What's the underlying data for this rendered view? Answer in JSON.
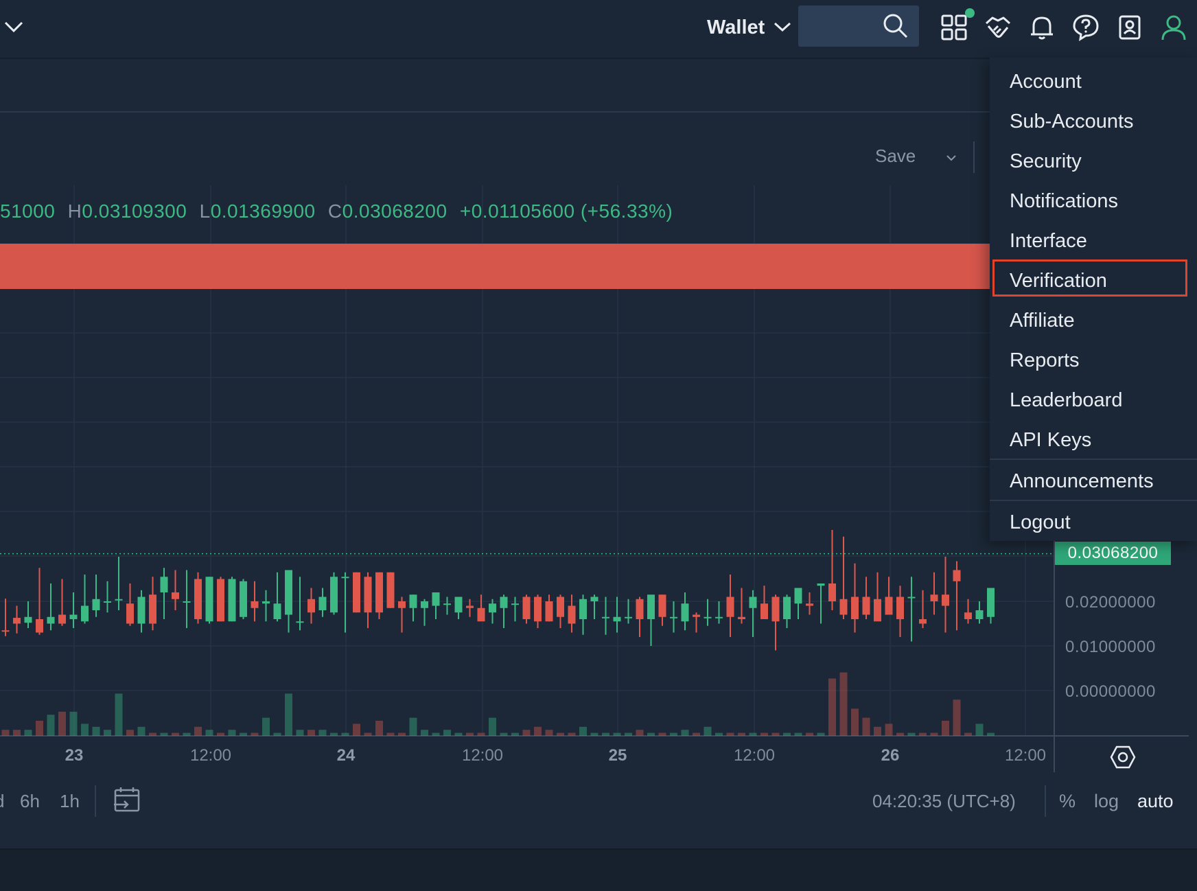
{
  "header": {
    "wallet_label": "Wallet",
    "search": {
      "value": "",
      "placeholder": ""
    },
    "icons": [
      "apps-grid-icon",
      "handshake-icon",
      "bell-icon",
      "help-icon",
      "contacts-icon",
      "user-icon"
    ],
    "notification_dot_color": "#3dba84"
  },
  "chart_toolbar": {
    "save_label": "Save"
  },
  "ohlc": {
    "open_value": "51000",
    "high_key": "H",
    "high_value": "0.03109300",
    "low_key": "L",
    "low_value": "0.01369900",
    "close_key": "C",
    "close_value": "0.03068200",
    "change": "+0.01105600 (+56.33%)"
  },
  "colors": {
    "up": "#3dba84",
    "down": "#e0574c",
    "banner": "#d6564c",
    "menu_highlight": "#e0442c"
  },
  "price_axis": {
    "last_price": "0.03068200",
    "labels": [
      "0.02000000",
      "0.01000000",
      "0.00000000"
    ]
  },
  "time_axis": {
    "labels": [
      {
        "text": "23",
        "bold": true
      },
      {
        "text": "12:00",
        "bold": false
      },
      {
        "text": "24",
        "bold": true
      },
      {
        "text": "12:00",
        "bold": false
      },
      {
        "text": "25",
        "bold": true
      },
      {
        "text": "12:00",
        "bold": false
      },
      {
        "text": "26",
        "bold": true
      },
      {
        "text": "12:00",
        "bold": false
      }
    ]
  },
  "bottom_toolbar": {
    "timeframes": [
      "d",
      "6h",
      "1h"
    ],
    "clock": "04:20:35 (UTC+8)",
    "options": {
      "percent": "%",
      "log": "log",
      "auto": "auto"
    }
  },
  "account_menu": {
    "items": [
      "Account",
      "Sub-Accounts",
      "Security",
      "Notifications",
      "Interface",
      "Verification",
      "Affiliate",
      "Reports",
      "Leaderboard",
      "API Keys",
      "Announcements",
      "Logout"
    ],
    "highlighted": "Verification"
  },
  "chart_data": {
    "type": "candlestick",
    "y_axis": {
      "range": [
        0,
        0.031
      ]
    },
    "last_price": 0.030682,
    "x_axis_ticks": [
      "23",
      "12:00",
      "24",
      "12:00",
      "25",
      "12:00",
      "26",
      "12:00"
    ],
    "candles": [
      {
        "o": 0.0135,
        "h": 0.0206,
        "l": 0.0122,
        "c": 0.0133,
        "v": 2
      },
      {
        "o": 0.0163,
        "h": 0.019,
        "l": 0.0128,
        "c": 0.015,
        "v": 2
      },
      {
        "o": 0.0152,
        "h": 0.02,
        "l": 0.014,
        "c": 0.0165,
        "v": 2
      },
      {
        "o": 0.016,
        "h": 0.0275,
        "l": 0.0125,
        "c": 0.013,
        "v": 5
      },
      {
        "o": 0.015,
        "h": 0.024,
        "l": 0.0135,
        "c": 0.0165,
        "v": 7
      },
      {
        "o": 0.017,
        "h": 0.025,
        "l": 0.0145,
        "c": 0.015,
        "v": 8
      },
      {
        "o": 0.016,
        "h": 0.022,
        "l": 0.014,
        "c": 0.017,
        "v": 8
      },
      {
        "o": 0.0155,
        "h": 0.026,
        "l": 0.015,
        "c": 0.019,
        "v": 4
      },
      {
        "o": 0.018,
        "h": 0.026,
        "l": 0.0165,
        "c": 0.0205,
        "v": 3
      },
      {
        "o": 0.02,
        "h": 0.0245,
        "l": 0.0175,
        "c": 0.02,
        "v": 2
      },
      {
        "o": 0.0205,
        "h": 0.03,
        "l": 0.018,
        "c": 0.0205,
        "v": 14
      },
      {
        "o": 0.0195,
        "h": 0.024,
        "l": 0.0145,
        "c": 0.015,
        "v": 2
      },
      {
        "o": 0.015,
        "h": 0.0225,
        "l": 0.013,
        "c": 0.021,
        "v": 3
      },
      {
        "o": 0.0215,
        "h": 0.0255,
        "l": 0.0135,
        "c": 0.015,
        "v": 1
      },
      {
        "o": 0.022,
        "h": 0.0275,
        "l": 0.016,
        "c": 0.0255,
        "v": 1
      },
      {
        "o": 0.022,
        "h": 0.027,
        "l": 0.018,
        "c": 0.0205,
        "v": 1
      },
      {
        "o": 0.02,
        "h": 0.027,
        "l": 0.014,
        "c": 0.02,
        "v": 1
      },
      {
        "o": 0.025,
        "h": 0.0265,
        "l": 0.015,
        "c": 0.016,
        "v": 3
      },
      {
        "o": 0.0155,
        "h": 0.0255,
        "l": 0.015,
        "c": 0.0255,
        "v": 2
      },
      {
        "o": 0.025,
        "h": 0.0255,
        "l": 0.0155,
        "c": 0.0155,
        "v": 1
      },
      {
        "o": 0.0155,
        "h": 0.0255,
        "l": 0.0155,
        "c": 0.025,
        "v": 2
      },
      {
        "o": 0.0165,
        "h": 0.025,
        "l": 0.016,
        "c": 0.0245,
        "v": 1
      },
      {
        "o": 0.02,
        "h": 0.0245,
        "l": 0.0155,
        "c": 0.0185,
        "v": 1
      },
      {
        "o": 0.0195,
        "h": 0.0225,
        "l": 0.0155,
        "c": 0.02,
        "v": 6
      },
      {
        "o": 0.016,
        "h": 0.0265,
        "l": 0.0155,
        "c": 0.0195,
        "v": 1
      },
      {
        "o": 0.017,
        "h": 0.027,
        "l": 0.013,
        "c": 0.027,
        "v": 14
      },
      {
        "o": 0.0155,
        "h": 0.0255,
        "l": 0.0135,
        "c": 0.0155,
        "v": 2
      },
      {
        "o": 0.0205,
        "h": 0.023,
        "l": 0.015,
        "c": 0.0175,
        "v": 2
      },
      {
        "o": 0.018,
        "h": 0.023,
        "l": 0.0165,
        "c": 0.021,
        "v": 2
      },
      {
        "o": 0.0175,
        "h": 0.0265,
        "l": 0.017,
        "c": 0.0255,
        "v": 1
      },
      {
        "o": 0.0255,
        "h": 0.0265,
        "l": 0.013,
        "c": 0.0255,
        "v": 1
      },
      {
        "o": 0.0265,
        "h": 0.0265,
        "l": 0.0175,
        "c": 0.0175,
        "v": 4
      },
      {
        "o": 0.0255,
        "h": 0.0265,
        "l": 0.014,
        "c": 0.0175,
        "v": 1
      },
      {
        "o": 0.0265,
        "h": 0.0265,
        "l": 0.016,
        "c": 0.0175,
        "v": 5
      },
      {
        "o": 0.0265,
        "h": 0.0265,
        "l": 0.0185,
        "c": 0.0185,
        "v": 1
      },
      {
        "o": 0.02,
        "h": 0.021,
        "l": 0.013,
        "c": 0.0185,
        "v": 1
      },
      {
        "o": 0.0185,
        "h": 0.0215,
        "l": 0.0155,
        "c": 0.0215,
        "v": 6
      },
      {
        "o": 0.0185,
        "h": 0.0205,
        "l": 0.0145,
        "c": 0.02,
        "v": 2
      },
      {
        "o": 0.019,
        "h": 0.022,
        "l": 0.016,
        "c": 0.022,
        "v": 1
      },
      {
        "o": 0.0195,
        "h": 0.021,
        "l": 0.017,
        "c": 0.0195,
        "v": 2
      },
      {
        "o": 0.0175,
        "h": 0.02,
        "l": 0.016,
        "c": 0.021,
        "v": 1
      },
      {
        "o": 0.019,
        "h": 0.0205,
        "l": 0.0165,
        "c": 0.0185,
        "v": 1
      },
      {
        "o": 0.0185,
        "h": 0.0215,
        "l": 0.016,
        "c": 0.0155,
        "v": 1
      },
      {
        "o": 0.0175,
        "h": 0.0205,
        "l": 0.015,
        "c": 0.0195,
        "v": 6
      },
      {
        "o": 0.0185,
        "h": 0.0215,
        "l": 0.014,
        "c": 0.021,
        "v": 1
      },
      {
        "o": 0.0195,
        "h": 0.021,
        "l": 0.0155,
        "c": 0.0195,
        "v": 1
      },
      {
        "o": 0.021,
        "h": 0.0215,
        "l": 0.015,
        "c": 0.016,
        "v": 2
      },
      {
        "o": 0.021,
        "h": 0.0215,
        "l": 0.014,
        "c": 0.0155,
        "v": 3
      },
      {
        "o": 0.02,
        "h": 0.0215,
        "l": 0.0155,
        "c": 0.0155,
        "v": 2
      },
      {
        "o": 0.021,
        "h": 0.0215,
        "l": 0.014,
        "c": 0.0165,
        "v": 1
      },
      {
        "o": 0.019,
        "h": 0.0215,
        "l": 0.013,
        "c": 0.015,
        "v": 1
      },
      {
        "o": 0.016,
        "h": 0.0215,
        "l": 0.0125,
        "c": 0.0205,
        "v": 3
      },
      {
        "o": 0.02,
        "h": 0.0215,
        "l": 0.016,
        "c": 0.021,
        "v": 1
      },
      {
        "o": 0.0165,
        "h": 0.021,
        "l": 0.0125,
        "c": 0.0165,
        "v": 1
      },
      {
        "o": 0.0155,
        "h": 0.021,
        "l": 0.013,
        "c": 0.0165,
        "v": 1
      },
      {
        "o": 0.0165,
        "h": 0.0205,
        "l": 0.015,
        "c": 0.0165,
        "v": 1
      },
      {
        "o": 0.0205,
        "h": 0.021,
        "l": 0.012,
        "c": 0.016,
        "v": 2
      },
      {
        "o": 0.016,
        "h": 0.021,
        "l": 0.01,
        "c": 0.0215,
        "v": 1
      },
      {
        "o": 0.0215,
        "h": 0.0215,
        "l": 0.0145,
        "c": 0.0165,
        "v": 1
      },
      {
        "o": 0.0165,
        "h": 0.02,
        "l": 0.013,
        "c": 0.0165,
        "v": 1
      },
      {
        "o": 0.0155,
        "h": 0.022,
        "l": 0.0135,
        "c": 0.0195,
        "v": 2
      },
      {
        "o": 0.017,
        "h": 0.0175,
        "l": 0.013,
        "c": 0.0165,
        "v": 1
      },
      {
        "o": 0.0165,
        "h": 0.0205,
        "l": 0.0145,
        "c": 0.0165,
        "v": 3
      },
      {
        "o": 0.0165,
        "h": 0.02,
        "l": 0.015,
        "c": 0.0165,
        "v": 1
      },
      {
        "o": 0.021,
        "h": 0.026,
        "l": 0.012,
        "c": 0.0165,
        "v": 1
      },
      {
        "o": 0.0165,
        "h": 0.023,
        "l": 0.015,
        "c": 0.016,
        "v": 1
      },
      {
        "o": 0.0185,
        "h": 0.0225,
        "l": 0.012,
        "c": 0.021,
        "v": 1
      },
      {
        "o": 0.0195,
        "h": 0.0235,
        "l": 0.016,
        "c": 0.016,
        "v": 1
      },
      {
        "o": 0.021,
        "h": 0.0215,
        "l": 0.009,
        "c": 0.0155,
        "v": 1
      },
      {
        "o": 0.016,
        "h": 0.0215,
        "l": 0.014,
        "c": 0.021,
        "v": 1
      },
      {
        "o": 0.0195,
        "h": 0.022,
        "l": 0.016,
        "c": 0.023,
        "v": 1
      },
      {
        "o": 0.0195,
        "h": 0.022,
        "l": 0.017,
        "c": 0.019,
        "v": 1
      },
      {
        "o": 0.0235,
        "h": 0.024,
        "l": 0.015,
        "c": 0.024,
        "v": 1
      },
      {
        "o": 0.024,
        "h": 0.036,
        "l": 0.018,
        "c": 0.02,
        "v": 19
      },
      {
        "o": 0.0205,
        "h": 0.0345,
        "l": 0.016,
        "c": 0.017,
        "v": 21
      },
      {
        "o": 0.021,
        "h": 0.0285,
        "l": 0.013,
        "c": 0.016,
        "v": 9
      },
      {
        "o": 0.021,
        "h": 0.0255,
        "l": 0.016,
        "c": 0.017,
        "v": 6
      },
      {
        "o": 0.0205,
        "h": 0.0265,
        "l": 0.016,
        "c": 0.0155,
        "v": 3
      },
      {
        "o": 0.021,
        "h": 0.0255,
        "l": 0.017,
        "c": 0.017,
        "v": 4
      },
      {
        "o": 0.021,
        "h": 0.0235,
        "l": 0.012,
        "c": 0.016,
        "v": 1
      },
      {
        "o": 0.021,
        "h": 0.0255,
        "l": 0.011,
        "c": 0.021,
        "v": 1
      },
      {
        "o": 0.016,
        "h": 0.0225,
        "l": 0.014,
        "c": 0.015,
        "v": 1
      },
      {
        "o": 0.0215,
        "h": 0.0265,
        "l": 0.017,
        "c": 0.02,
        "v": 1
      },
      {
        "o": 0.0215,
        "h": 0.03,
        "l": 0.013,
        "c": 0.019,
        "v": 5
      },
      {
        "o": 0.027,
        "h": 0.029,
        "l": 0.0135,
        "c": 0.0245,
        "v": 12
      },
      {
        "o": 0.0175,
        "h": 0.0205,
        "l": 0.015,
        "c": 0.016,
        "v": 1
      },
      {
        "o": 0.016,
        "h": 0.02,
        "l": 0.015,
        "c": 0.018,
        "v": 4
      },
      {
        "o": 0.0165,
        "h": 0.0215,
        "l": 0.015,
        "c": 0.023,
        "v": 1
      }
    ]
  }
}
